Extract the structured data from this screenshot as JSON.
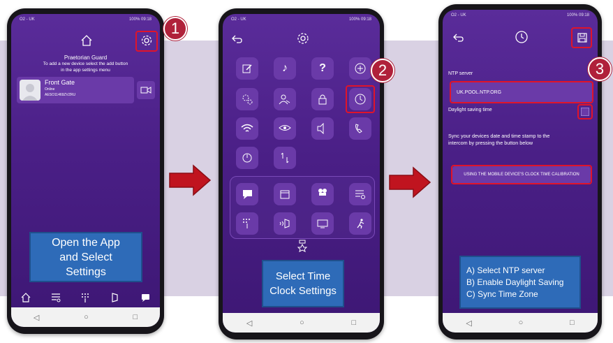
{
  "steps": [
    {
      "number": "1"
    },
    {
      "number": "2"
    },
    {
      "number": "3"
    }
  ],
  "status": {
    "left": "O2 - UK",
    "right": "100% 09:18"
  },
  "phone1": {
    "app_name": "Praetorian Guard",
    "instructions_line1": "To add a new device select the add button",
    "instructions_line2": "in the app settings menu",
    "device_name": "Front Gate",
    "device_status": "Online",
    "device_id": "AESO11469ZVZRU",
    "callout": [
      "Open the App",
      "and Select",
      "Settings"
    ]
  },
  "phone2": {
    "callout": [
      "Select Time",
      "Clock Settings"
    ]
  },
  "phone3": {
    "ntp_label": "NTP server",
    "ntp_value": "UK.POOL.NTP.ORG",
    "dst_label": "Daylight saving time",
    "sync_text_line1": "Sync your devices date and time stamp to the",
    "sync_text_line2": "intercom by pressing the button below",
    "calibrate_button": "USING THE MOBILE DEVICE'S CLOCK TIME CALIBRATION",
    "callout": [
      "A) Select NTP server",
      "B) Enable Daylight Saving",
      "C) Sync Time Zone"
    ]
  },
  "nav_glyphs": {
    "back": "◁",
    "home": "○",
    "recent": "□"
  },
  "colors": {
    "accent": "#e0142a",
    "badge": "#b0213a",
    "callout": "#2e6bb8",
    "screen": "#4a1f86",
    "band": "#d9d1e3"
  }
}
